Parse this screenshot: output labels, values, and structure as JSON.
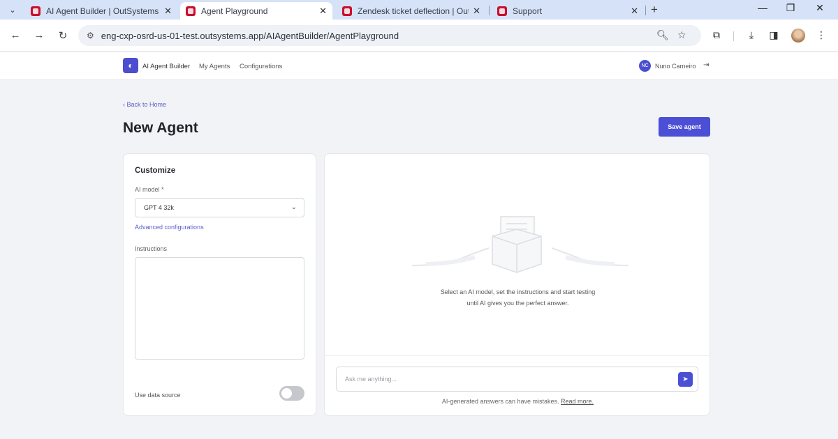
{
  "browser": {
    "tabs": [
      {
        "label": "AI Agent Builder | OutSystems",
        "active": false
      },
      {
        "label": "Agent Playground",
        "active": true
      },
      {
        "label": "Zendesk ticket deflection | Out",
        "active": false
      },
      {
        "label": "Support",
        "active": false
      }
    ],
    "url": "eng-cxp-osrd-us-01-test.outsystems.app/AIAgentBuilder/AgentPlayground"
  },
  "header": {
    "app_title": "AI Agent Builder",
    "nav": [
      "My Agents",
      "Configurations"
    ],
    "user_initials": "NC",
    "user_name": "Nuno Carneiro"
  },
  "page": {
    "back_link": "‹ Back to Home",
    "title": "New Agent",
    "save_label": "Save agent"
  },
  "customize": {
    "title": "Customize",
    "model_label": "AI model *",
    "model_value": "GPT 4 32k",
    "advanced_link": "Advanced configurations",
    "instructions_label": "Instructions",
    "data_source_label": "Use data source",
    "data_source_on": false
  },
  "playground": {
    "empty_line1": "Select an AI model, set the instructions and start testing",
    "empty_line2": "until AI gives you the perfect answer.",
    "input_placeholder": "Ask me anything...",
    "disclaimer": "AI-generated answers can have mistakes.",
    "read_more": "Read more."
  },
  "colors": {
    "accent": "#4b4fd6",
    "tabstrip": "#d6e2f7"
  }
}
